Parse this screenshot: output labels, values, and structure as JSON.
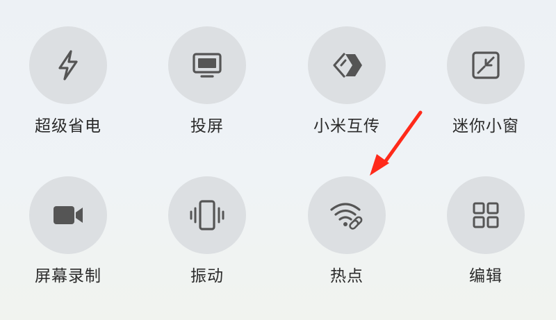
{
  "tiles": [
    {
      "label": "超级省电",
      "icon": "lightning-bolt-icon"
    },
    {
      "label": "投屏",
      "icon": "monitor-icon"
    },
    {
      "label": "小米互传",
      "icon": "transfer-arrows-icon"
    },
    {
      "label": "迷你小窗",
      "icon": "mini-window-icon"
    },
    {
      "label": "屏幕录制",
      "icon": "video-camera-icon"
    },
    {
      "label": "振动",
      "icon": "vibrate-phone-icon"
    },
    {
      "label": "热点",
      "icon": "wifi-hotspot-icon"
    },
    {
      "label": "编辑",
      "icon": "grid-edit-icon"
    }
  ],
  "colors": {
    "tile_background": "#dcdfe2",
    "icon": "#555555",
    "label": "#2a2a2a",
    "annotation_arrow": "#ff2a1a"
  }
}
